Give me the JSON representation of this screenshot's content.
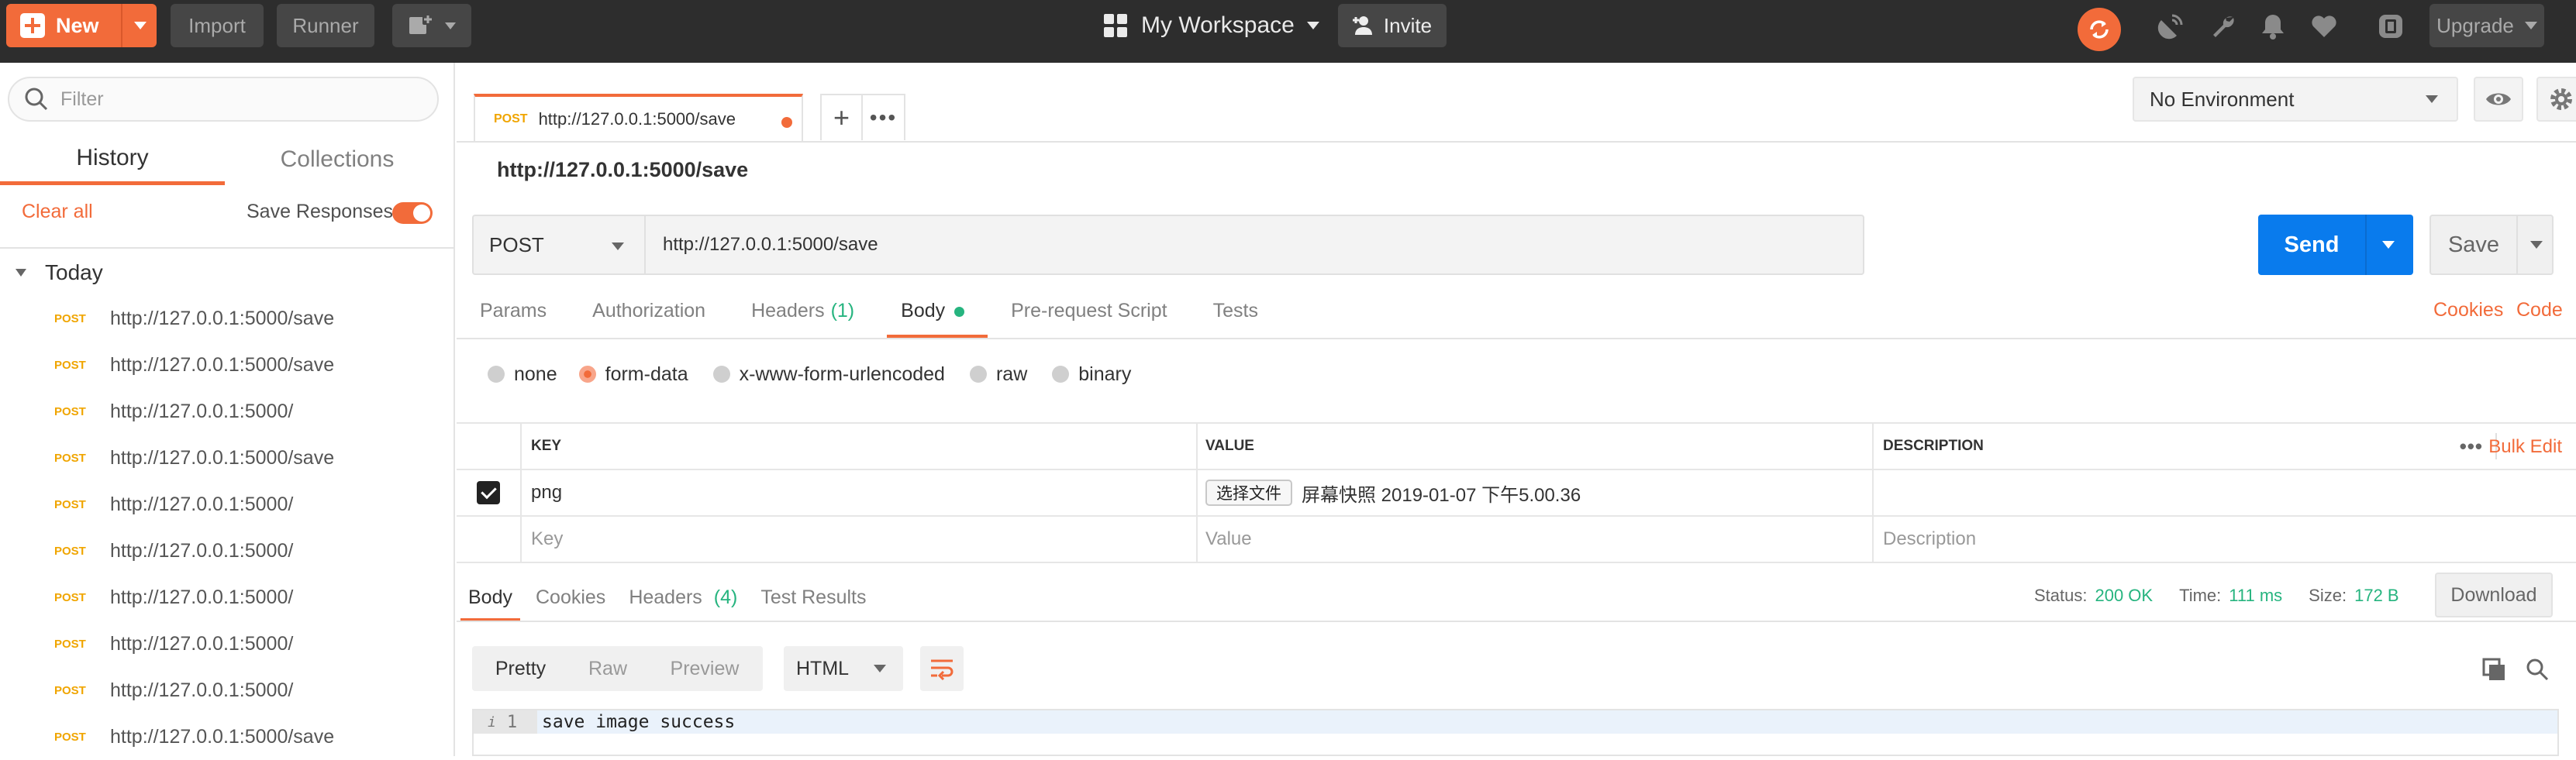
{
  "topbar": {
    "new_label": "New",
    "import_label": "Import",
    "runner_label": "Runner",
    "workspace_label": "My Workspace",
    "invite_label": "Invite",
    "upgrade_label": "Upgrade"
  },
  "sidebar": {
    "filter_placeholder": "Filter",
    "tabs": [
      "History",
      "Collections"
    ],
    "clear_all": "Clear all",
    "save_responses": "Save Responses",
    "group_label": "Today",
    "history": [
      {
        "method": "POST",
        "url": "http://127.0.0.1:5000/save"
      },
      {
        "method": "POST",
        "url": "http://127.0.0.1:5000/save"
      },
      {
        "method": "POST",
        "url": "http://127.0.0.1:5000/"
      },
      {
        "method": "POST",
        "url": "http://127.0.0.1:5000/save"
      },
      {
        "method": "POST",
        "url": "http://127.0.0.1:5000/"
      },
      {
        "method": "POST",
        "url": "http://127.0.0.1:5000/"
      },
      {
        "method": "POST",
        "url": "http://127.0.0.1:5000/"
      },
      {
        "method": "POST",
        "url": "http://127.0.0.1:5000/"
      },
      {
        "method": "POST",
        "url": "http://127.0.0.1:5000/"
      },
      {
        "method": "POST",
        "url": "http://127.0.0.1:5000/save"
      }
    ]
  },
  "tab": {
    "method": "POST",
    "url": "http://127.0.0.1:5000/save"
  },
  "environment": {
    "label": "No Environment"
  },
  "request": {
    "title": "http://127.0.0.1:5000/save",
    "method": "POST",
    "url": "http://127.0.0.1:5000/save",
    "send_label": "Send",
    "save_label": "Save",
    "tabs": {
      "params": "Params",
      "authorization": "Authorization",
      "headers": "Headers",
      "headers_count": "(1)",
      "body": "Body",
      "prerequest": "Pre-request Script",
      "tests": "Tests"
    },
    "cookies_link": "Cookies",
    "code_link": "Code",
    "body_types": [
      "none",
      "form-data",
      "x-www-form-urlencoded",
      "raw",
      "binary"
    ],
    "params_table": {
      "headers": {
        "key": "KEY",
        "value": "VALUE",
        "description": "DESCRIPTION"
      },
      "bulk_edit": "Bulk Edit",
      "row": {
        "key": "png",
        "file_button": "选择文件",
        "file_name": "屏幕快照 2019-01-07 下午5.00.36"
      },
      "placeholders": {
        "key": "Key",
        "value": "Value",
        "description": "Description"
      }
    }
  },
  "response": {
    "tabs": {
      "body": "Body",
      "cookies": "Cookies",
      "headers": "Headers",
      "headers_count": "(4)",
      "tests": "Test Results"
    },
    "status_label": "Status:",
    "status_value": "200 OK",
    "time_label": "Time:",
    "time_value": "111 ms",
    "size_label": "Size:",
    "size_value": "172 B",
    "download_label": "Download",
    "views": [
      "Pretty",
      "Raw",
      "Preview"
    ],
    "format": "HTML",
    "line_number": "1",
    "line_icon": "i",
    "body_text": "save image success"
  },
  "colors": {
    "accent": "#f26b3a",
    "send": "#097bed",
    "success": "#26b47f"
  },
  "icons": [
    "plus-icon",
    "add-window-icon",
    "grid-icon",
    "add-user-icon",
    "sync-icon",
    "satellite-icon",
    "wrench-icon",
    "bell-icon",
    "heart-icon",
    "interceptor-icon",
    "search-icon",
    "eye-icon",
    "gear-icon",
    "wrap-icon",
    "copy-icon"
  ]
}
